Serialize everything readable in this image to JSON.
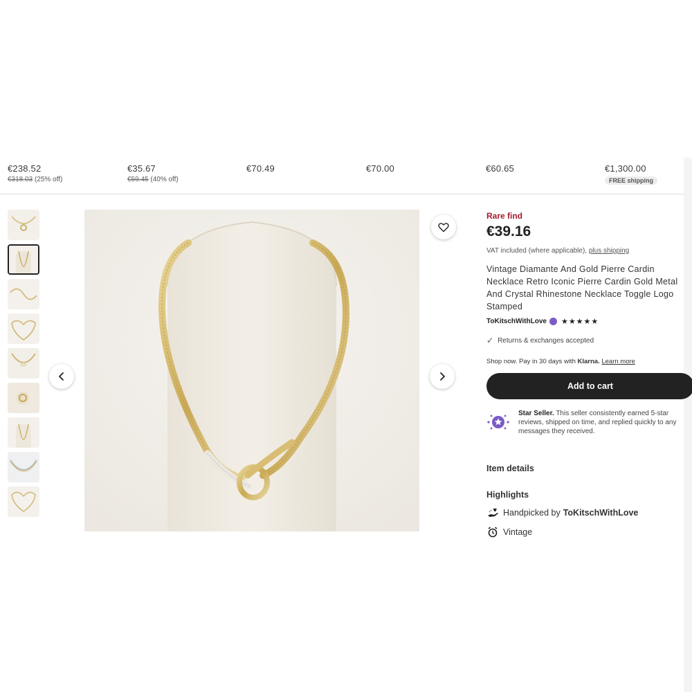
{
  "recommendations": [
    {
      "price": "€238.52",
      "original": "€318.03",
      "discount": "(25% off)"
    },
    {
      "price": "€35.67",
      "original": "€59.45",
      "discount": "(40% off)"
    },
    {
      "price": "€70.49"
    },
    {
      "price": "€70.00"
    },
    {
      "price": "€60.65"
    },
    {
      "price": "€1,300.00",
      "badge": "FREE shipping"
    }
  ],
  "gallery": {
    "thumbnail_count": 9,
    "active_index": 1,
    "prev_icon": "chevron-left-icon",
    "next_icon": "chevron-right-icon",
    "favorite_icon": "heart-icon"
  },
  "listing": {
    "rare_label": "Rare find",
    "price": "€39.16",
    "vat_text": "VAT included (where applicable),",
    "shipping_link": "plus shipping",
    "title": "Vintage Diamante And Gold Pierre Cardin Necklace Retro Iconic Pierre Cardin Gold Metal And Crystal Rhinestone Necklace Toggle Logo Stamped",
    "seller_name": "ToKitschWithLove",
    "rating_stars": "★★★★★",
    "returns_text": "Returns & exchanges accepted",
    "klarna_prefix": "Shop now. Pay in 30 days with",
    "klarna_brand": "Klarna.",
    "klarna_link": "Learn more",
    "add_to_cart": "Add to cart",
    "star_seller_title": "Star Seller.",
    "star_seller_text": "This seller consistently earned 5-star reviews, shipped on time, and replied quickly to any messages they received.",
    "item_details_label": "Item details",
    "highlights_label": "Highlights",
    "highlight_handpicked": "Handpicked by",
    "highlight_seller": "ToKitschWithLove",
    "highlight_vintage": "Vintage"
  },
  "colors": {
    "rare": "#a61a2e",
    "cart_button": "#222222",
    "star_seller": "#7b5cc4"
  }
}
